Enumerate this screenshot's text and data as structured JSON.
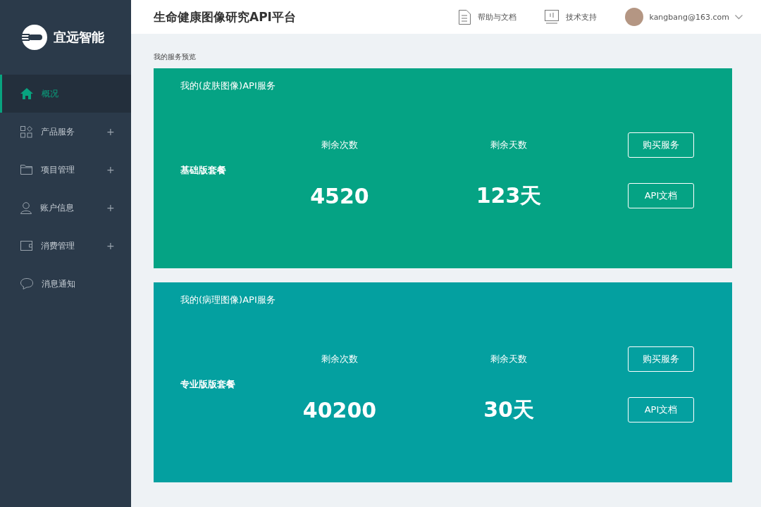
{
  "sidebar": {
    "brand": "宜远智能",
    "items": [
      {
        "label": "概况",
        "selected": true
      },
      {
        "label": "产品服务",
        "selected": false,
        "toggle": "+"
      },
      {
        "label": "项目管理",
        "selected": false,
        "toggle": "+"
      },
      {
        "label": "账户信息",
        "selected": false,
        "toggle": "+"
      },
      {
        "label": "消费管理",
        "selected": false,
        "toggle": "+"
      },
      {
        "label": "消息通知",
        "selected": false
      }
    ]
  },
  "header": {
    "title": "生命健康图像研究API平台",
    "links": [
      {
        "label": "帮助与文档"
      },
      {
        "label": "技术支持"
      }
    ],
    "user": "kangbang@163.com"
  },
  "breadcrumb": "我的服务预览",
  "services": [
    {
      "title": "我的(皮肤图像)API服务",
      "plan": "基础版套餐",
      "color": "#05a384",
      "stats": [
        {
          "label": "剩余次数",
          "value": "4520"
        },
        {
          "label": "剩余天数",
          "value": "123天"
        }
      ],
      "buttons": [
        "购买服务",
        "API文档"
      ]
    },
    {
      "title": "我的(病理图像)API服务",
      "plan": "专业版版套餐",
      "color": "#04a0a0",
      "stats": [
        {
          "label": "剩余次数",
          "value": "40200"
        },
        {
          "label": "剩余天数",
          "value": "30天"
        }
      ],
      "buttons": [
        "购买服务",
        "API文档"
      ]
    }
  ]
}
